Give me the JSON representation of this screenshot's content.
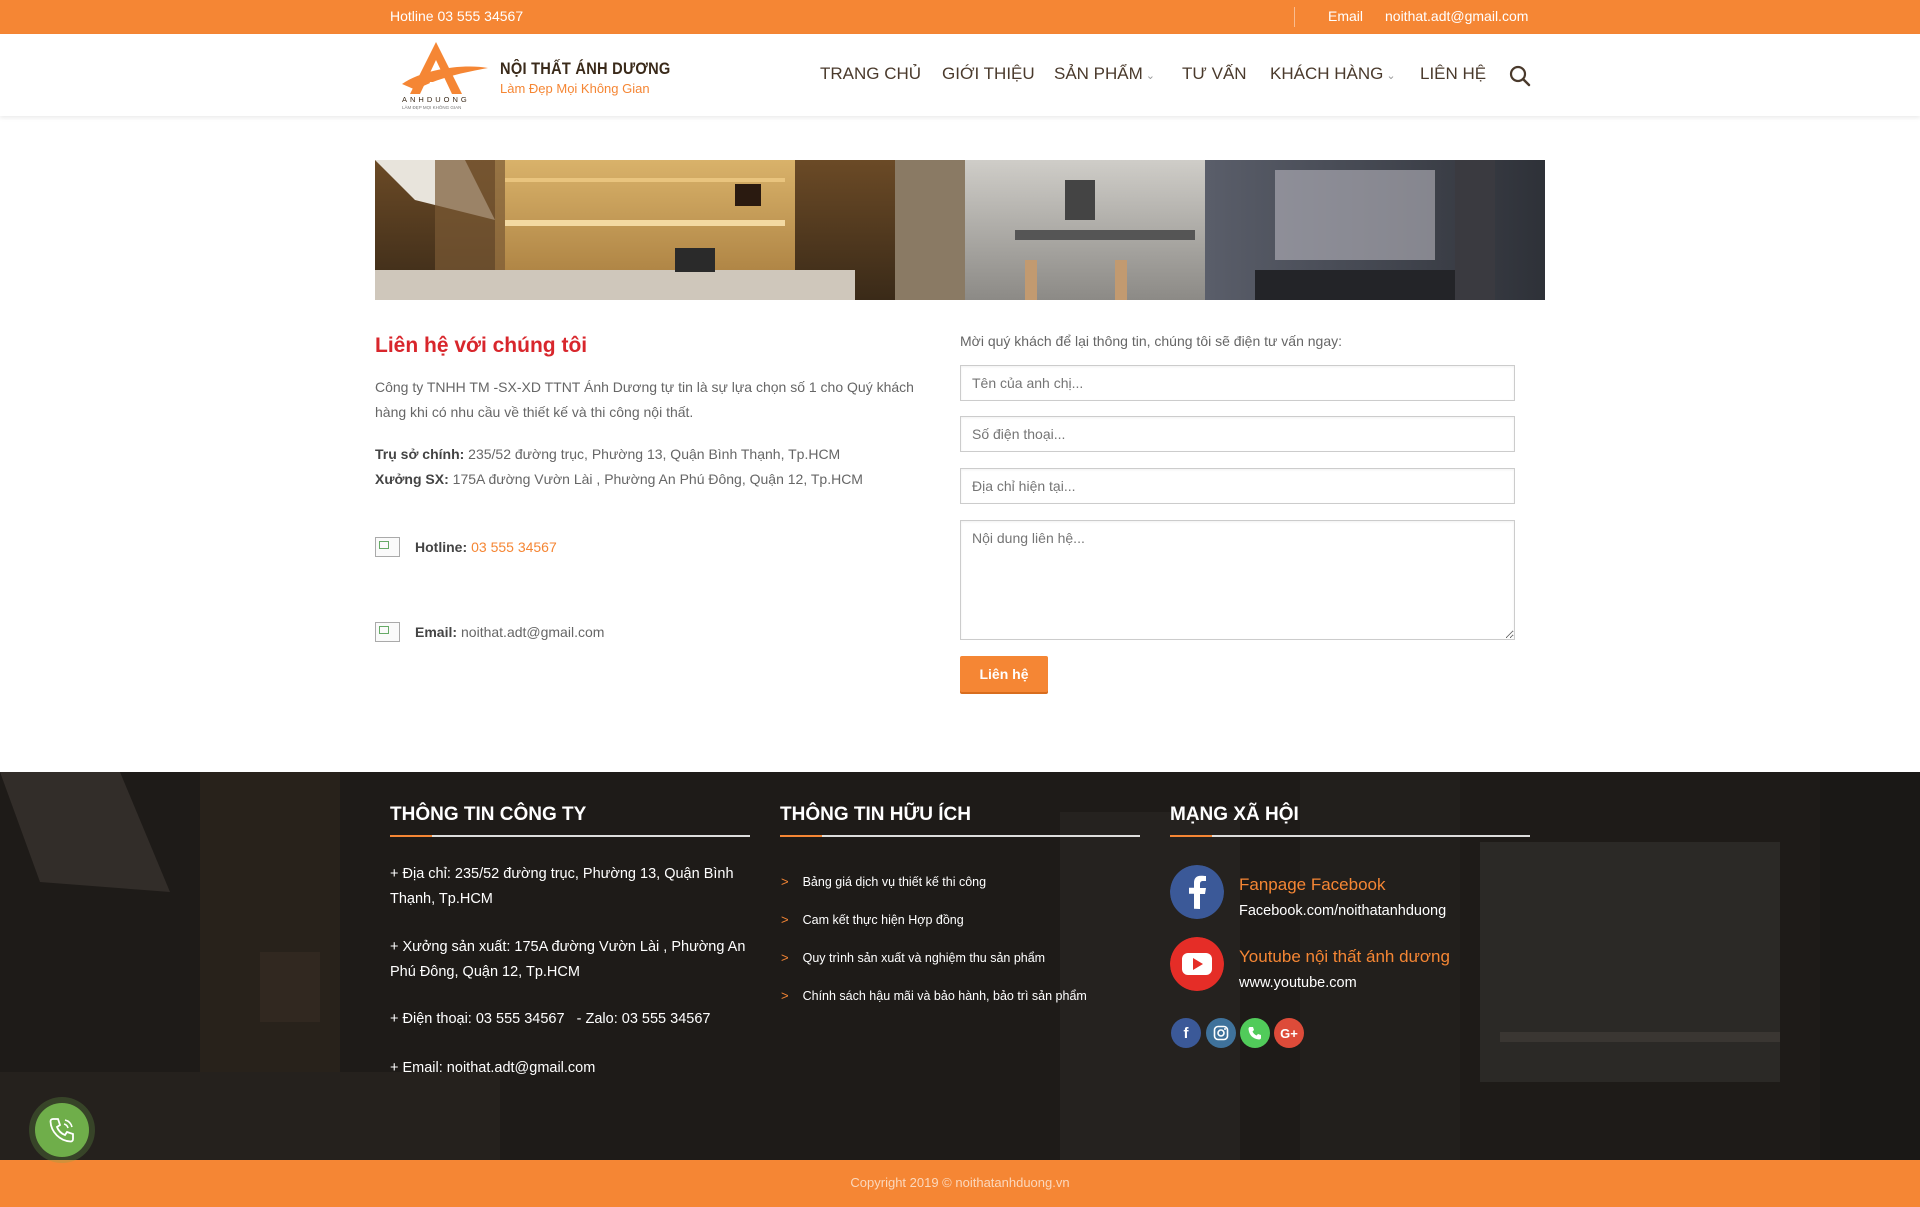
{
  "topbar": {
    "hotline": "Hotline 03 555 34567",
    "email_label": "Email",
    "email_value": "noithat.adt@gmail.com"
  },
  "header": {
    "logo_brand": "NỘI THẤT ÁNH DƯƠNG",
    "logo_slogan": "Làm Đẹp Mọi Không Gian",
    "logo_mark_text": "ANHDUONG",
    "logo_mark_sub": "LÀM ĐẸP MỌI KHÔNG GIAN",
    "nav": [
      {
        "label": "TRANG CHỦ"
      },
      {
        "label": "GIỚI THIỆU"
      },
      {
        "label": "SẢN PHẨM"
      },
      {
        "label": "TƯ VẤN"
      },
      {
        "label": "KHÁCH HÀNG"
      },
      {
        "label": "LIÊN HỆ"
      }
    ]
  },
  "contact": {
    "title": "Liên hệ với chúng tôi",
    "intro": "Công ty TNHH TM -SX-XD TTNT Ánh Dương tự tin là sự lựa chọn số 1 cho Quý khách hàng khi có nhu cầu về thiết kế và thi công nội thất.",
    "hq_label": "Trụ sở chính:",
    "hq_value": " 235/52 đường trục, Phường 13, Quận Bình Thạnh, Tp.HCM",
    "factory_label": "Xưởng SX:",
    "factory_value": " 175A đường Vườn Lài , Phường An Phú Đông, Quận 12, Tp.HCM",
    "hotline_label": "Hotline:",
    "hotline_value": "03 555 34567",
    "email_label": "Email:",
    "email_value": "noithat.adt@gmail.com"
  },
  "form": {
    "intro": "Mời quý khách để lại thông tin, chúng tôi sẽ điện tư vấn ngay:",
    "name_placeholder": "Tên của anh chị...",
    "phone_placeholder": "Số điện thoại...",
    "address_placeholder": "Địa chỉ hiện tại...",
    "message_placeholder": "Nội dung liên hệ...",
    "submit_label": "Liên hệ"
  },
  "footer": {
    "company": {
      "title": "THÔNG TIN CÔNG TY",
      "address": "+ Địa chỉ: 235/52 đường trục, Phường 13, Quận Bình Thạnh, Tp.HCM",
      "factory": "+ Xưởng sản xuất: 175A đường Vườn Lài , Phường An Phú Đông, Quận 12, Tp.HCM",
      "phone": "+ Điện thoại: 03 555 34567   - Zalo: 03 555 34567",
      "email": "+ Email: noithat.adt@gmail.com"
    },
    "useful": {
      "title": "THÔNG TIN HỮU ÍCH",
      "links": [
        {
          "label": "Bảng giá dịch vụ thiết kế thi công"
        },
        {
          "label": "Cam kết thực hiện Hợp đồng"
        },
        {
          "label": "Quy trình sản xuất và nghiệm thu sản phẩm"
        },
        {
          "label": "Chính sách hậu mãi và bảo hành, bảo trì sản phẩm"
        }
      ]
    },
    "social": {
      "title": "MẠNG XÃ HỘI",
      "facebook_title": "Fanpage Facebook",
      "facebook_url": "Facebook.com/noithatanhduong",
      "youtube_title": "Youtube nội thất ánh dương",
      "youtube_url": "www.youtube.com",
      "small_icons": [
        "facebook-icon",
        "instagram-icon",
        "phone-icon",
        "google-plus-icon"
      ],
      "gplus_text": "G+"
    },
    "copyright": "Copyright 2019 © noithatanhduong.vn"
  },
  "colors": {
    "accent": "#f58634",
    "title_red": "#d8262c",
    "footer_bg": "#1d1b19",
    "call_green": "#6fae4a"
  }
}
